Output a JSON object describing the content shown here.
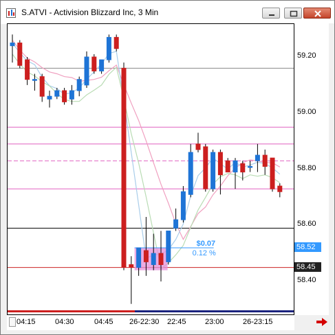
{
  "window": {
    "title": "S.ATVI - Activision Blizzard Inc, 3 Min"
  },
  "chart_data": {
    "type": "candlestick",
    "symbol": "S.ATVI",
    "title": "S.ATVI - Activision Blizzard Inc, 3 Min",
    "y_ticks": [
      "59.20",
      "59.00",
      "58.80",
      "58.60",
      "58.40"
    ],
    "ylim": [
      58.28,
      59.35
    ],
    "x_ticks": [
      "04:15",
      "04:30",
      "04:45",
      "26-22:30",
      "22:45",
      "23:00",
      "26-23:15"
    ],
    "price_boxes": [
      {
        "label": "58.52",
        "color": "#3399ff"
      },
      {
        "label": "58.45",
        "color": "#222222"
      }
    ],
    "measure": {
      "change": "$0.07",
      "percent": "0.12 %"
    },
    "candles": [
      {
        "o": 59.25,
        "h": 59.28,
        "l": 59.18,
        "c": 59.24,
        "dir": "up"
      },
      {
        "o": 59.25,
        "h": 59.26,
        "l": 59.16,
        "c": 59.17,
        "dir": "down"
      },
      {
        "o": 59.19,
        "h": 59.2,
        "l": 59.1,
        "c": 59.12,
        "dir": "down"
      },
      {
        "o": 59.12,
        "h": 59.14,
        "l": 59.08,
        "c": 59.12,
        "dir": "up"
      },
      {
        "o": 59.13,
        "h": 59.14,
        "l": 59.04,
        "c": 59.06,
        "dir": "down"
      },
      {
        "o": 59.06,
        "h": 59.08,
        "l": 59.02,
        "c": 59.05,
        "dir": "up"
      },
      {
        "o": 59.06,
        "h": 59.09,
        "l": 59.05,
        "c": 59.08,
        "dir": "up"
      },
      {
        "o": 59.08,
        "h": 59.09,
        "l": 59.03,
        "c": 59.04,
        "dir": "down"
      },
      {
        "o": 59.05,
        "h": 59.1,
        "l": 59.03,
        "c": 59.08,
        "dir": "up"
      },
      {
        "o": 59.08,
        "h": 59.13,
        "l": 59.06,
        "c": 59.12,
        "dir": "up"
      },
      {
        "o": 59.1,
        "h": 59.22,
        "l": 59.09,
        "c": 59.2,
        "dir": "up"
      },
      {
        "o": 59.2,
        "h": 59.21,
        "l": 59.14,
        "c": 59.15,
        "dir": "down"
      },
      {
        "o": 59.15,
        "h": 59.19,
        "l": 59.14,
        "c": 59.19,
        "dir": "up"
      },
      {
        "o": 59.19,
        "h": 59.28,
        "l": 59.18,
        "c": 59.27,
        "dir": "up"
      },
      {
        "o": 59.27,
        "h": 59.28,
        "l": 59.22,
        "c": 59.23,
        "dir": "down"
      },
      {
        "o": 59.16,
        "h": 59.18,
        "l": 58.44,
        "c": 58.45,
        "dir": "down"
      },
      {
        "o": 58.46,
        "h": 58.49,
        "l": 58.32,
        "c": 58.45,
        "dir": "down"
      },
      {
        "o": 58.45,
        "h": 58.52,
        "l": 58.42,
        "c": 58.52,
        "dir": "up"
      },
      {
        "o": 58.51,
        "h": 58.63,
        "l": 58.42,
        "c": 58.47,
        "dir": "down"
      },
      {
        "o": 58.46,
        "h": 58.57,
        "l": 58.44,
        "c": 58.5,
        "dir": "up"
      },
      {
        "o": 58.5,
        "h": 58.58,
        "l": 58.4,
        "c": 58.46,
        "dir": "down"
      },
      {
        "o": 58.47,
        "h": 58.58,
        "l": 58.46,
        "c": 58.58,
        "dir": "up"
      },
      {
        "o": 58.59,
        "h": 58.66,
        "l": 58.58,
        "c": 58.62,
        "dir": "up"
      },
      {
        "o": 58.62,
        "h": 58.74,
        "l": 58.61,
        "c": 58.72,
        "dir": "up"
      },
      {
        "o": 58.71,
        "h": 58.89,
        "l": 58.7,
        "c": 58.86,
        "dir": "up"
      },
      {
        "o": 58.89,
        "h": 58.93,
        "l": 58.86,
        "c": 58.87,
        "dir": "down"
      },
      {
        "o": 58.88,
        "h": 58.89,
        "l": 58.72,
        "c": 58.73,
        "dir": "down"
      },
      {
        "o": 58.73,
        "h": 58.87,
        "l": 58.72,
        "c": 58.86,
        "dir": "up"
      },
      {
        "o": 58.86,
        "h": 58.87,
        "l": 58.71,
        "c": 58.78,
        "dir": "down"
      },
      {
        "o": 58.83,
        "h": 58.84,
        "l": 58.79,
        "c": 58.79,
        "dir": "down"
      },
      {
        "o": 58.79,
        "h": 58.84,
        "l": 58.73,
        "c": 58.83,
        "dir": "up"
      },
      {
        "o": 58.82,
        "h": 58.83,
        "l": 58.76,
        "c": 58.79,
        "dir": "down"
      },
      {
        "o": 58.81,
        "h": 58.83,
        "l": 58.79,
        "c": 58.81,
        "dir": "up"
      },
      {
        "o": 58.85,
        "h": 58.89,
        "l": 58.79,
        "c": 58.83,
        "dir": "up"
      },
      {
        "o": 58.85,
        "h": 58.87,
        "l": 58.78,
        "c": 58.81,
        "dir": "down"
      },
      {
        "o": 58.84,
        "h": 58.84,
        "l": 58.72,
        "c": 58.73,
        "dir": "down"
      },
      {
        "o": 58.74,
        "h": 58.75,
        "l": 58.7,
        "c": 58.72,
        "dir": "down"
      }
    ],
    "lines": {
      "hline_gray_top": 59.16,
      "hline_pink_1": 58.95,
      "hline_pink_2": 58.89,
      "hline_pink_dash": 58.83,
      "hline_pink_4": 58.73,
      "hline_black": 58.59,
      "hline_red": 58.45
    },
    "colors": {
      "up": "#1e74d6",
      "down": "#cc1f1f",
      "ma_pink": "#f0a0c0",
      "ma_blue": "#a9cdea",
      "ma_green": "#b9dcb4",
      "hline_magenta": "#e060c0",
      "hline_black": "#000000",
      "hline_red": "#cc2222",
      "hline_gray": "#888888",
      "measure_box": "#e58fd8",
      "measure_text": "#3399ff"
    }
  }
}
